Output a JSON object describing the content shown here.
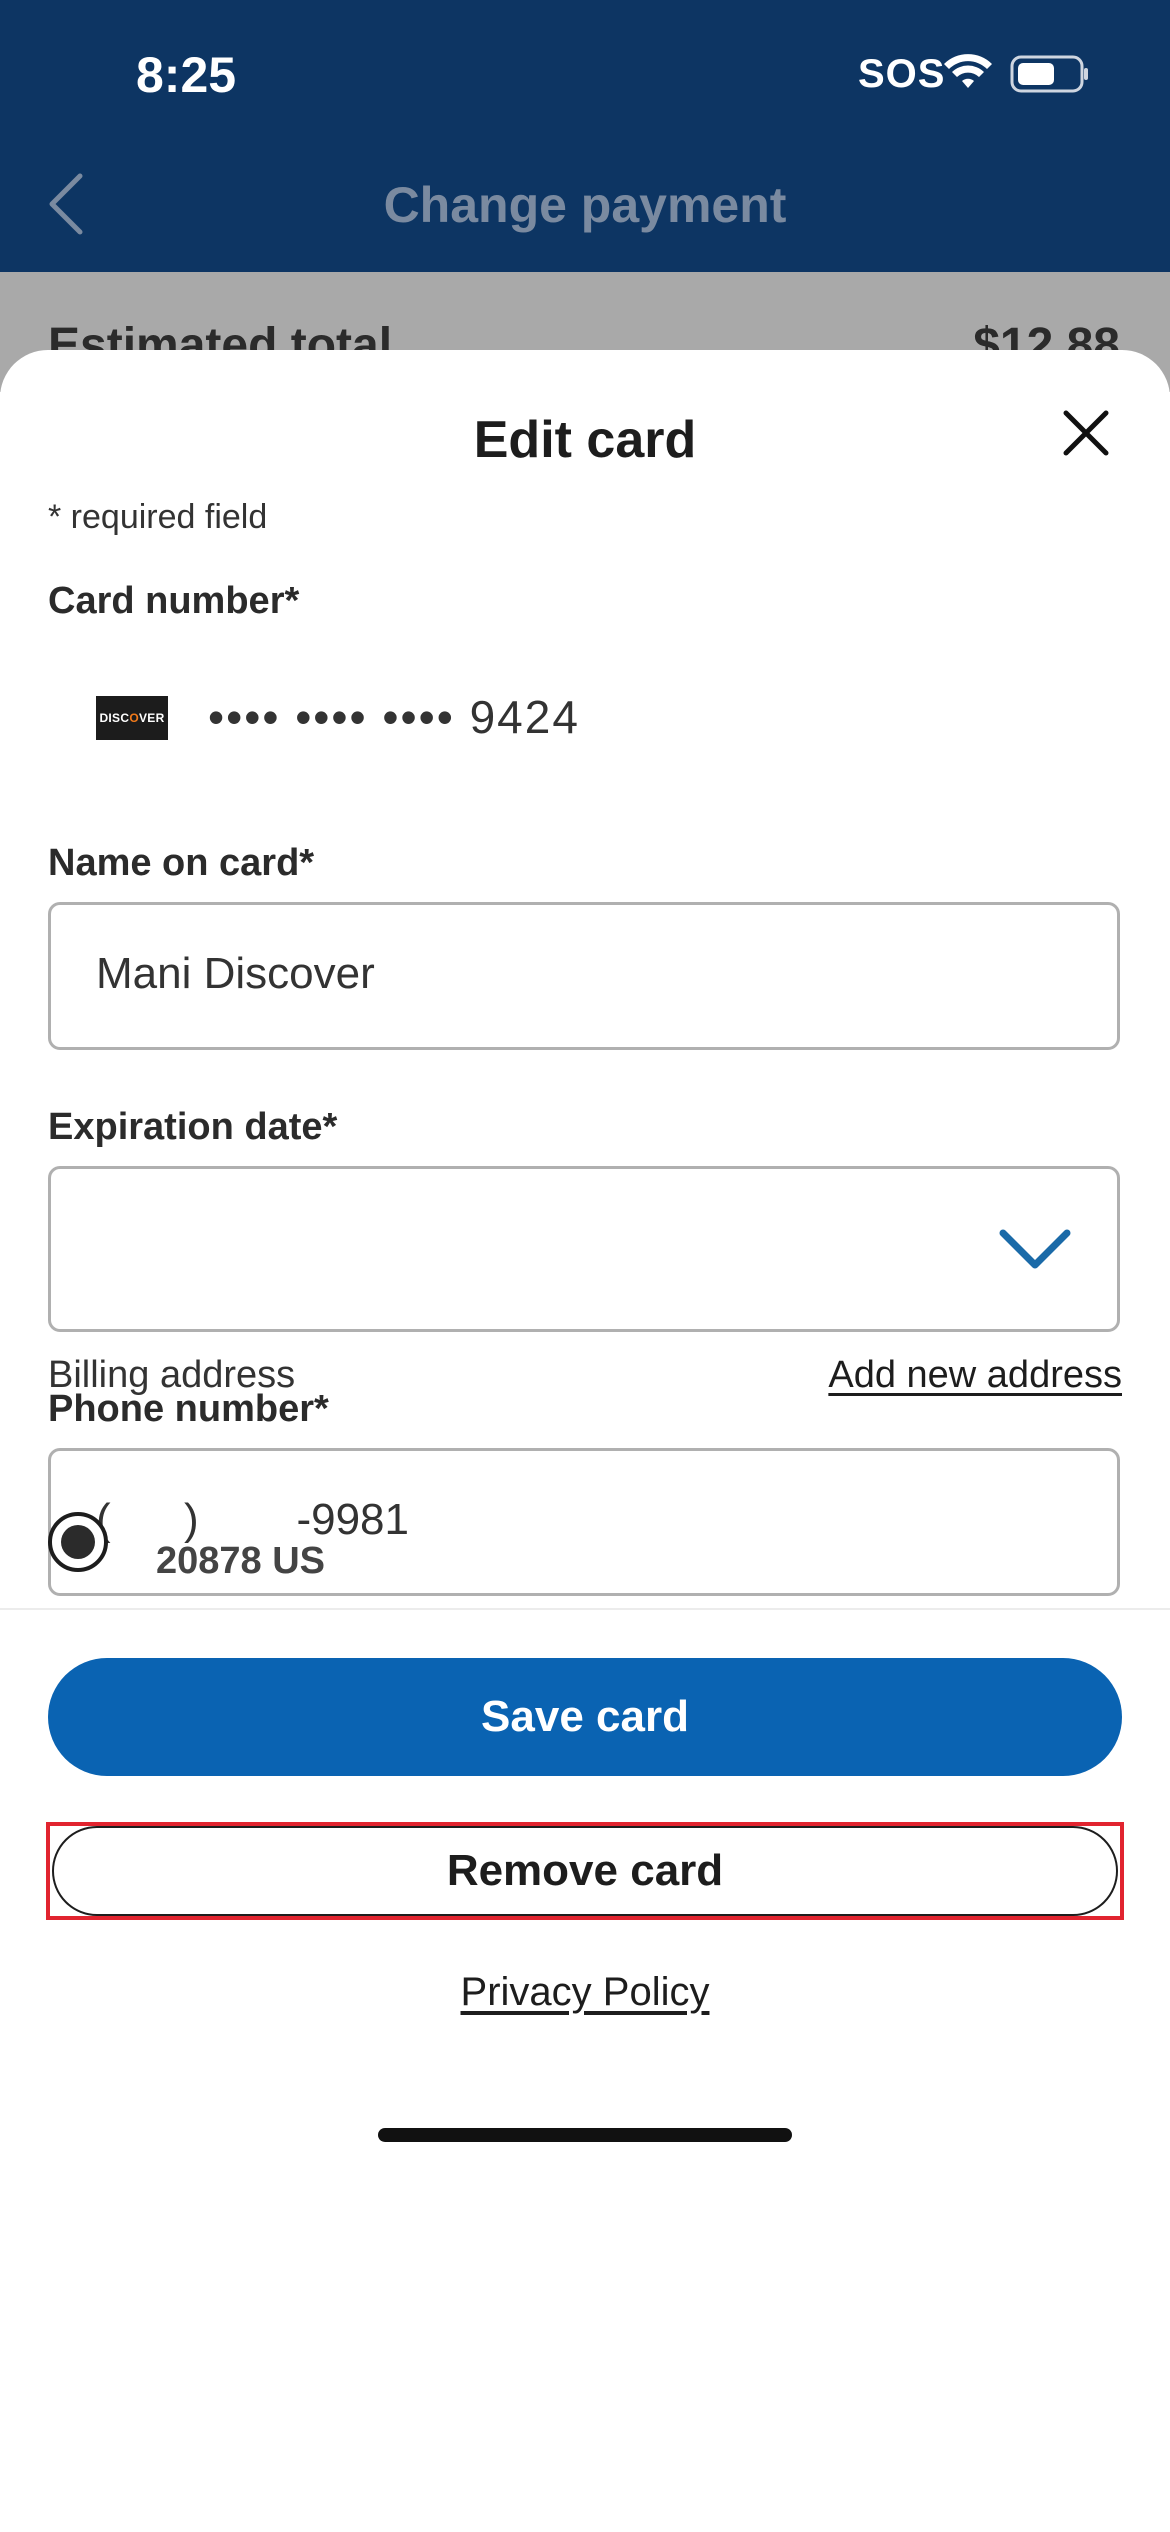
{
  "status_bar": {
    "time": "8:25",
    "sos": "SOS",
    "icons": [
      "wifi-icon",
      "battery-icon"
    ]
  },
  "nav": {
    "title": "Change payment",
    "back_icon": "chevron-left-icon"
  },
  "background": {
    "estimated_total_label": "Estimated total",
    "estimated_total_value": "$12.88"
  },
  "sheet": {
    "title": "Edit card",
    "close_icon": "close-icon",
    "required_note": "* required field",
    "card_number": {
      "label": "Card number*",
      "brand": "DISCOVER",
      "masked_value": "•••• •••• •••• 9424"
    },
    "name_on_card": {
      "label": "Name on card*",
      "value": "Mani Discover"
    },
    "expiration_date": {
      "label": "Expiration date*",
      "value": "",
      "dropdown_icon": "chevron-down-icon"
    },
    "phone_number": {
      "label": "Phone number*",
      "value": "(      )        -9981"
    },
    "billing": {
      "label": "Billing address",
      "add_link": "Add new address",
      "selected_address": "20878 US"
    },
    "save_button": "Save card",
    "remove_button": "Remove card",
    "privacy_link": "Privacy Policy"
  },
  "colors": {
    "header_bg": "#0d3563",
    "primary_button": "#0a63b2",
    "highlight_border": "#e1242f",
    "dropdown_chevron": "#1a6aa8"
  }
}
